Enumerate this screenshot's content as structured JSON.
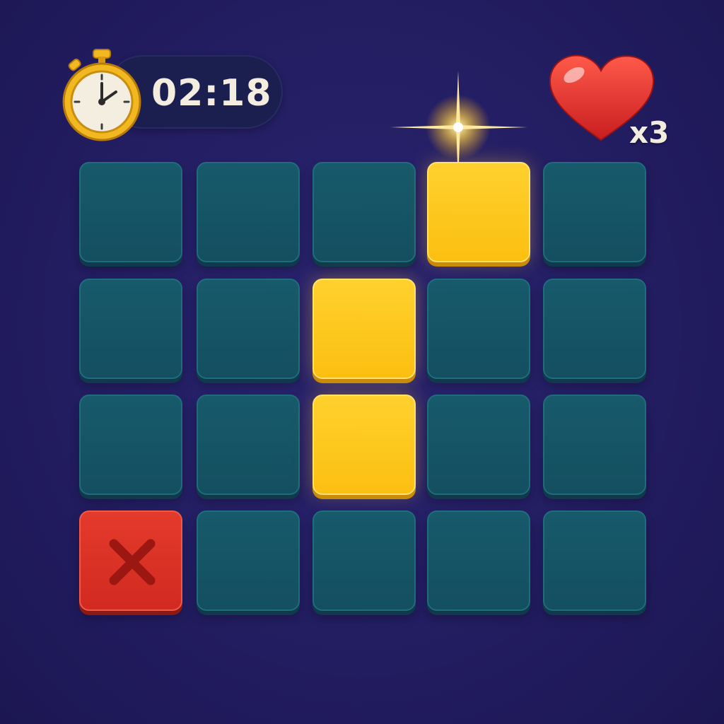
{
  "hud": {
    "timer": "02:18",
    "lives": "x3"
  },
  "icons": {
    "timer": "stopwatch-icon",
    "lives": "heart-icon",
    "sparkle": "sparkle-icon",
    "wrong": "x-mark-icon"
  },
  "colors": {
    "background": "#231d62",
    "tile_empty": "#155668",
    "tile_lit": "#fcc61b",
    "tile_wrong": "#da3025",
    "heart": "#e8302c",
    "stopwatch": "#f1b21c"
  },
  "board": {
    "rows": 4,
    "cols": 5,
    "tiles": [
      [
        "empty",
        "empty",
        "empty",
        "lit",
        "empty"
      ],
      [
        "empty",
        "empty",
        "lit",
        "empty",
        "empty"
      ],
      [
        "empty",
        "empty",
        "lit",
        "empty",
        "empty"
      ],
      [
        "wrong",
        "empty",
        "empty",
        "empty",
        "empty"
      ]
    ]
  }
}
